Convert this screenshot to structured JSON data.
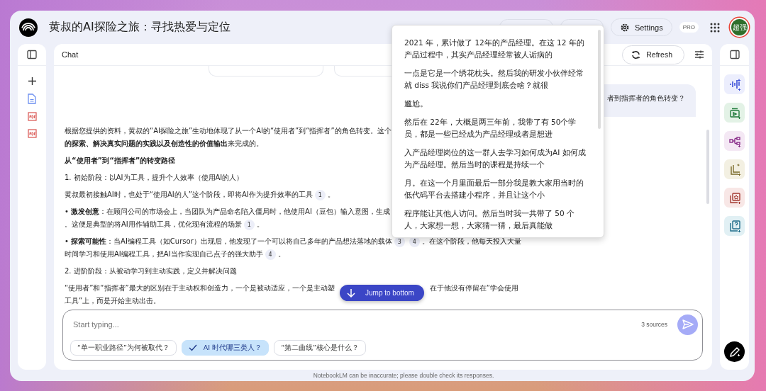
{
  "header": {
    "title": "黄叔的AI探险之旅：寻找热爱与定位",
    "settings": "Settings",
    "plan": "PRO",
    "avatar": "超强"
  },
  "sources_sidebar": {
    "items": [
      {
        "kind": "doc"
      },
      {
        "kind": "pdf"
      },
      {
        "kind": "pdf"
      }
    ]
  },
  "chat": {
    "title": "Chat",
    "refresh": "Refresh",
    "user_message": "者到指挥者的角色转变？",
    "paragraphs": [
      {
        "kind": "body",
        "lines": [
          [
            {
              "kind": "text",
              "text": "根据您提供的资料，黄叔的“AI探险之旅”生动地体现了从一个AI的“使用者”到“指挥者”的角色转变。这个"
            }
          ],
          [
            {
              "kind": "text",
              "text": "**的探索、解决真实问题的实践以及创造性的价值输出**来完成的。"
            }
          ]
        ]
      },
      {
        "kind": "heading",
        "lines": [
          [
            {
              "kind": "text",
              "text": "从“使用者”到“指挥者”的转变路径"
            }
          ]
        ]
      },
      {
        "kind": "body",
        "lines": [
          [
            {
              "kind": "text",
              "text": "1. 初始阶段：以AI为工具，提升个人效率（使用AI的人）"
            }
          ]
        ]
      },
      {
        "kind": "body",
        "lines": [
          [
            {
              "kind": "text",
              "text": "黄叔最初接触AI时，也处于“使用AI的人”这个阶段，即将AI作为提升效率的工具"
            },
            {
              "kind": "cite",
              "text": "1"
            },
            {
              "kind": "text",
              "text": "。"
            }
          ]
        ]
      },
      {
        "kind": "body",
        "lines": [
          [
            {
              "kind": "text",
              "text": "• **激发创意**：在顾问公司的市场会上，当团队为产品命名陷入僵局时，他使用AI（豆包）输入意图，生成"
            }
          ],
          [
            {
              "kind": "text",
              "text": "。这便是典型的将AI用作辅助工具，优化现有流程的场景"
            },
            {
              "kind": "cite",
              "text": "1"
            },
            {
              "kind": "text",
              "text": "。"
            }
          ]
        ]
      },
      {
        "kind": "body",
        "lines": [
          [
            {
              "kind": "text",
              "text": "• **探索可能性**：当AI编程工具（如Cursor）出现后，他发现了一个可以将自己多年的产品想法落地的载体"
            },
            {
              "kind": "cite",
              "text": "3"
            },
            {
              "kind": "cite",
              "text": "4"
            },
            {
              "kind": "text",
              "text": "。在这个阶段，他每天投入大量"
            }
          ],
          [
            {
              "kind": "text",
              "text": "时间学习和使用AI编程工具，把AI当作实现自己点子的强大助手"
            },
            {
              "kind": "cite",
              "text": "4"
            },
            {
              "kind": "text",
              "text": "。"
            }
          ]
        ]
      },
      {
        "kind": "body",
        "lines": [
          [
            {
              "kind": "text",
              "text": "2. 进阶阶段：从被动学习到主动实践，定义并解决问题"
            }
          ]
        ]
      },
      {
        "kind": "body",
        "lines": [
          [
            {
              "kind": "text",
              "text": "“使用者”和“指挥者”最大的区别在于主动权和创造力，一个是被动适应，一个是主动塑"
            },
            {
              "kind": "gap"
            },
            {
              "kind": "text",
              "text": "在于他没有停留在“学会使用"
            }
          ],
          [
            {
              "kind": "text",
              "text": "工具”上，而是开始主动出击。"
            }
          ]
        ]
      }
    ],
    "jump_button": "Jump to bottom",
    "input": {
      "placeholder": "Start typing...",
      "sources": "3 sources"
    },
    "suggestions": [
      {
        "label": "“单一职业路径”为何被取代？",
        "selected": false
      },
      {
        "label": "AI 时代哪三类人？",
        "selected": true
      },
      {
        "label": "“第二曲线”核心是什么？",
        "selected": false
      }
    ]
  },
  "popup": {
    "paragraphs": [
      "2021 年，累计做了 12年的产品经理。在这 12 年的产品过程中，其实产品经理经常被人诟病的",
      "一点是它是一个绣花枕头。然后我的研发小伙伴经常就 diss 我说你们产品经理到底会啥？就很",
      "尴尬。",
      "然后在 22年，大概是两三年前，我带了有 50个学员，都是一些已经成为产品经理或者是想进",
      "入产品经理岗位的这一群人去学习如何成为AI 如何成为产品经理。然后当时的课程是持续一个",
      "月。在这一个月里面最后一部分我是教大家用当时的低代码平台去搭建小程序，并且让这个小",
      "程序能让其他人访问。然后当时我一共带了 50 个人，大家想一想，大家猜一猜，最后真能做"
    ]
  },
  "studio": {
    "tiles": [
      {
        "kind": "audio",
        "color": "#eceefd"
      },
      {
        "kind": "video",
        "color": "#e3f2e6"
      },
      {
        "kind": "mindmap",
        "color": "#f4e8f4"
      },
      {
        "kind": "report",
        "color": "#f3f0e2"
      },
      {
        "kind": "flashcards",
        "color": "#f8e7e6"
      },
      {
        "kind": "quiz",
        "color": "#e1f0f4"
      }
    ]
  },
  "disclaimer": "NotebookLM can be inaccurate; please double check its responses."
}
